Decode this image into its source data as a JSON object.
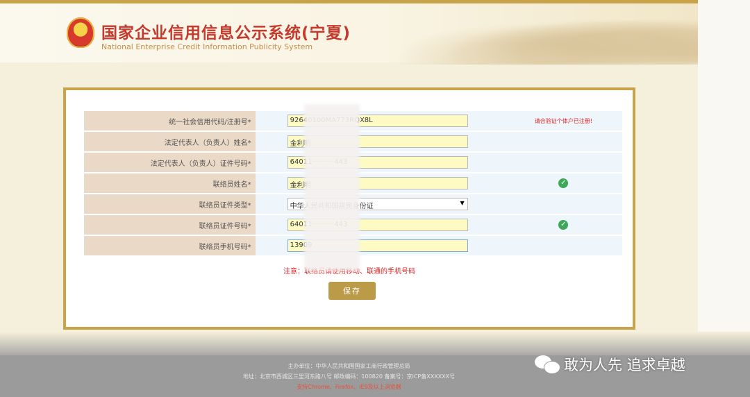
{
  "header": {
    "title_cn": "国家企业信用信息公示系统(宁夏)",
    "title_en": "National Enterprise Credit Information Publicity System"
  },
  "form": {
    "rows": [
      {
        "label": "统一社会信用代码/注册号*",
        "value": "92640100MA773RQX8L",
        "note": "请合验证个体户已注册!",
        "check": false,
        "kind": "text"
      },
      {
        "label": "法定代表人（负责人）姓名*",
        "value": "金利明",
        "note": "",
        "check": false,
        "kind": "text"
      },
      {
        "label": "法定代表人（负责人）证件号码*",
        "value": "64011··········443",
        "note": "",
        "check": false,
        "kind": "text"
      },
      {
        "label": "联络员姓名*",
        "value": "金利明",
        "note": "",
        "check": true,
        "kind": "text"
      },
      {
        "label": "联络员证件类型*",
        "value": "中华人民共和国居民身份证",
        "note": "",
        "check": false,
        "kind": "select"
      },
      {
        "label": "联络员证件号码*",
        "value": "64011··········443",
        "note": "",
        "check": true,
        "kind": "text"
      },
      {
        "label": "联络员手机号码*",
        "value": "13909",
        "note": "",
        "check": false,
        "kind": "text"
      }
    ],
    "notice": "注意：联络员请使用移动、联通的手机号码",
    "save_label": "保存"
  },
  "footer": {
    "line1": "主办单位：中华人民共和国国家工商行政管理总局",
    "line2": "地址：北京市西城区三里河东路八号 邮政编码：100820 备案号：京ICP备XXXXXX号",
    "line3": "支持Chrome、Firefox、IE9及以上浏览器",
    "line4": ""
  },
  "watermark": {
    "text": "敢为人先 追求卓越"
  },
  "colors": {
    "accent": "#c9a34a",
    "title": "#c43a2d",
    "label_bg": "#ead9c6",
    "input_bg": "#fdfbc3",
    "button": "#bb9a48",
    "check": "#3ea85a"
  }
}
